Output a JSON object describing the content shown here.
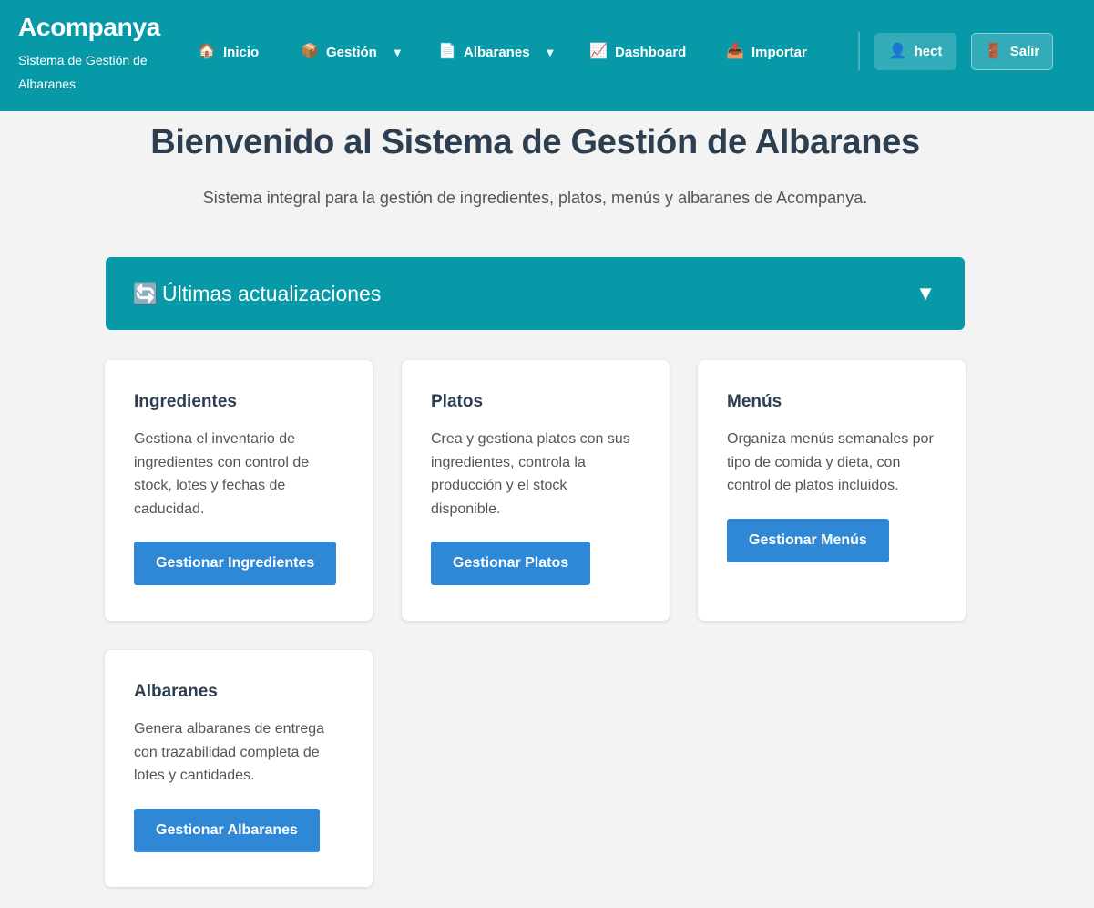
{
  "brand": {
    "title": "Acompanya",
    "subtitle": "Sistema de Gestión de Albaranes"
  },
  "nav": {
    "items": [
      {
        "label": "Inicio",
        "icon": "🏠",
        "icon_name": "house-icon"
      },
      {
        "label": "Gestión",
        "icon": "📦",
        "icon_name": "package-icon",
        "caret": "▼"
      },
      {
        "label": "Albaranes",
        "icon": "📄",
        "icon_name": "document-icon",
        "caret": "▼"
      },
      {
        "label": "Dashboard",
        "icon": "📈",
        "icon_name": "chart-icon"
      },
      {
        "label": "Importar",
        "icon": "📥",
        "icon_name": "inbox-tray-icon"
      }
    ],
    "user": {
      "label": "hect",
      "icon": "👤",
      "icon_name": "user-icon"
    },
    "logout": {
      "label": "Salir",
      "icon": "🚪",
      "icon_name": "door-icon"
    }
  },
  "page": {
    "title": "Bienvenido al Sistema de Gestión de Albaranes",
    "subtitle": "Sistema integral para la gestión de ingredientes, platos, menús y albaranes de Acompanya."
  },
  "updates": {
    "icon": "🔄",
    "label": "Últimas actualizaciones",
    "caret": "▼"
  },
  "cards": [
    {
      "title": "Ingredientes",
      "text": "Gestiona el inventario de ingredientes con control de stock, lotes y fechas de caducidad.",
      "button": "Gestionar Ingredientes"
    },
    {
      "title": "Platos",
      "text": "Crea y gestiona platos con sus ingredientes, controla la producción y el stock disponible.",
      "button": "Gestionar Platos"
    },
    {
      "title": "Menús",
      "text": "Organiza menús semanales por tipo de comida y dieta, con control de platos incluidos.",
      "button": "Gestionar Menús"
    },
    {
      "title": "Albaranes",
      "text": "Genera albaranes de entrega con trazabilidad completa de lotes y cantidades.",
      "button": "Gestionar Albaranes"
    }
  ],
  "colors": {
    "primary": "#0899a9",
    "button": "#2f88d6",
    "background": "#f3f3f3",
    "text": "#2c3e50"
  }
}
